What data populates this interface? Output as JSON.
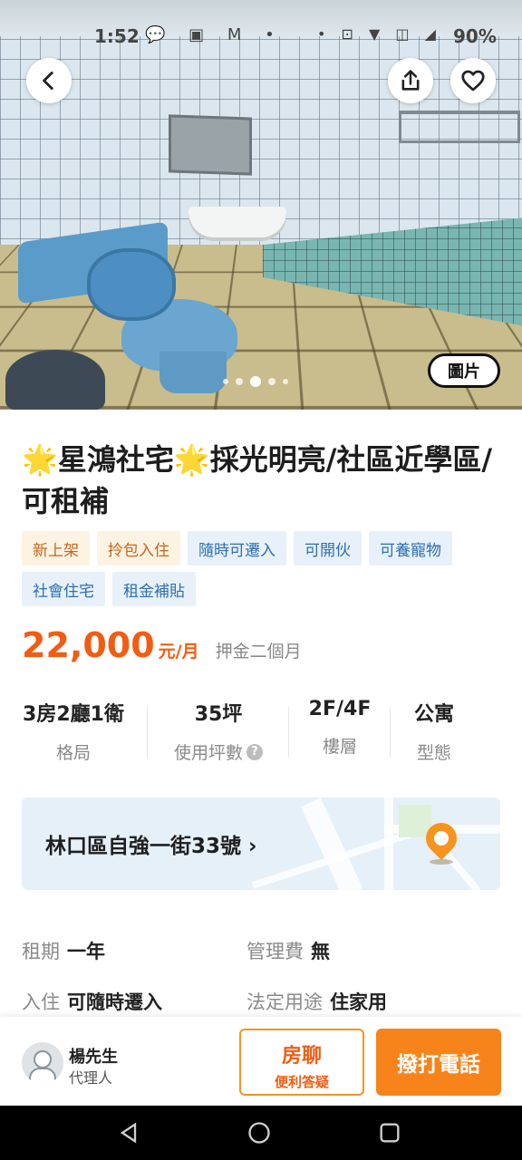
{
  "status_bar": {
    "time": "1:52",
    "left_icons": "💬 ▣ M •",
    "right_icons": "• ⊡ ▼ ◫ ◢",
    "battery": "90%"
  },
  "gallery": {
    "photo_label": "圖片",
    "dots": 5,
    "active_dot": 2
  },
  "listing": {
    "title_star": "🌟",
    "title_part1": "星鴻社宅",
    "title_part2": "採光明亮/社區近學區/可租補",
    "tags": [
      {
        "label": "新上架",
        "style": "warm"
      },
      {
        "label": "拎包入住",
        "style": "warm"
      },
      {
        "label": "隨時可遷入",
        "style": "cool"
      },
      {
        "label": "可開伙",
        "style": "cool"
      },
      {
        "label": "可養寵物",
        "style": "cool"
      },
      {
        "label": "社會住宅",
        "style": "cool"
      },
      {
        "label": "租金補貼",
        "style": "cool"
      }
    ],
    "price": "22,000",
    "price_unit": "元/月",
    "deposit": "押金二個月"
  },
  "specs": {
    "layout": {
      "value": "3房2廳1衛",
      "label": "格局"
    },
    "area": {
      "value": "35坪",
      "label": "使用坪數"
    },
    "floor": {
      "value": "2F/4F",
      "label": "樓層"
    },
    "type": {
      "value": "公寓",
      "label": "型態"
    }
  },
  "address": {
    "text": "林口區自強一街33號",
    "chevron": "›"
  },
  "details": {
    "lease_label": "租期",
    "lease_value": "一年",
    "fee_label": "管理費",
    "fee_value": "無",
    "movein_label": "入住",
    "movein_value": "可隨時遷入",
    "usage_label": "法定用途",
    "usage_value": "住家用"
  },
  "agent": {
    "name": "楊先生",
    "role": "代理人"
  },
  "actions": {
    "chat_main": "房聊",
    "chat_sub": "便利答疑",
    "call": "撥打電話"
  },
  "colors": {
    "accent": "#f25c12",
    "call_button": "#f7841a",
    "tag_warm_bg": "#fdf3e2",
    "tag_cool_bg": "#e8f1fa"
  }
}
